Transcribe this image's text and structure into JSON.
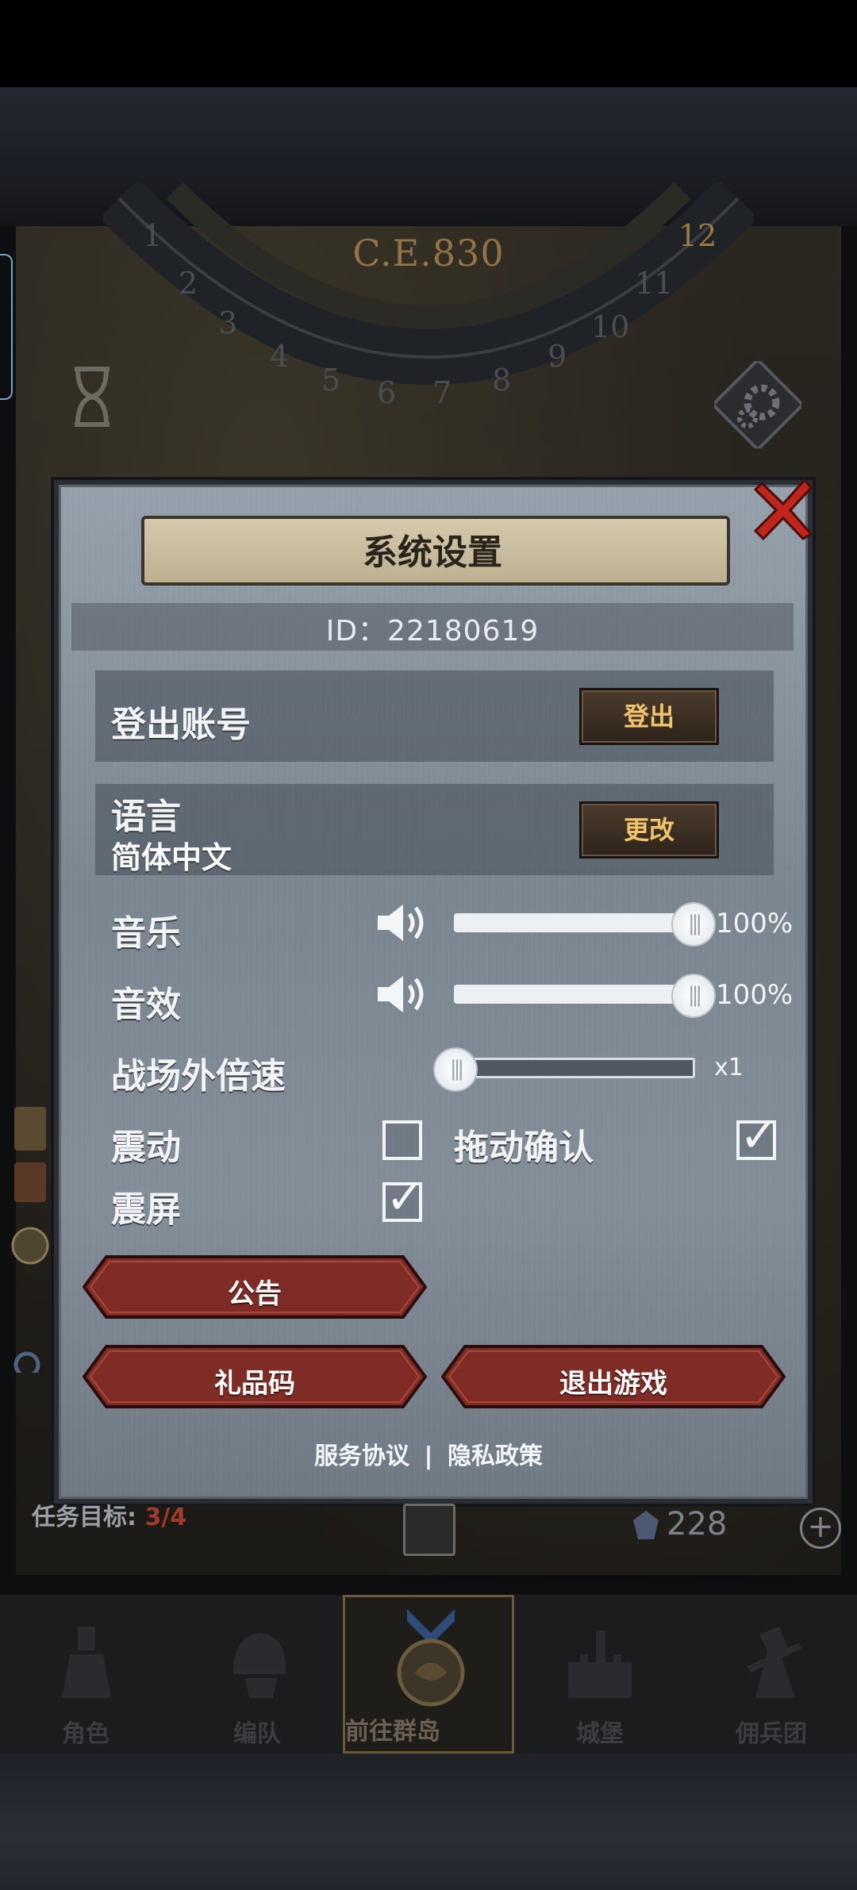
{
  "background": {
    "era_label": "C.E.830",
    "dial_numbers": [
      "1",
      "2",
      "3",
      "4",
      "5",
      "6",
      "7",
      "8",
      "9",
      "10",
      "11",
      "12"
    ],
    "mission_label": "任务目标:",
    "mission_progress": "3/4",
    "gem_count": "228"
  },
  "dialog": {
    "title": "系统设置",
    "id_text": "ID：22180619",
    "logout": {
      "label": "登出账号",
      "button": "登出"
    },
    "language": {
      "label": "语言",
      "value": "简体中文",
      "button": "更改"
    },
    "music": {
      "label": "音乐",
      "level": 1.0,
      "percent": "100%"
    },
    "sfx": {
      "label": "音效",
      "level": 1.0,
      "percent": "100%"
    },
    "speed": {
      "label": "战场外倍速",
      "level": 0.0,
      "value": "x1"
    },
    "vibrate": {
      "label": "震动",
      "checked": false
    },
    "drag_confirm": {
      "label": "拖动确认",
      "checked": true
    },
    "screen_shake": {
      "label": "震屏",
      "checked": true
    },
    "notice_button": "公告",
    "gift_code_button": "礼品码",
    "exit_button": "退出游戏",
    "terms_link": "服务协议",
    "separator": "|",
    "privacy_link": "隐私政策"
  },
  "nav": {
    "items": [
      {
        "label": "角色"
      },
      {
        "label": "编队"
      },
      {
        "label": "前往群岛",
        "active": true
      },
      {
        "label": "城堡"
      },
      {
        "label": "佣兵团"
      }
    ]
  },
  "colors": {
    "gold_text": "#f1c46b",
    "red_button": "#7e2c25",
    "close_red": "#c0251b"
  }
}
